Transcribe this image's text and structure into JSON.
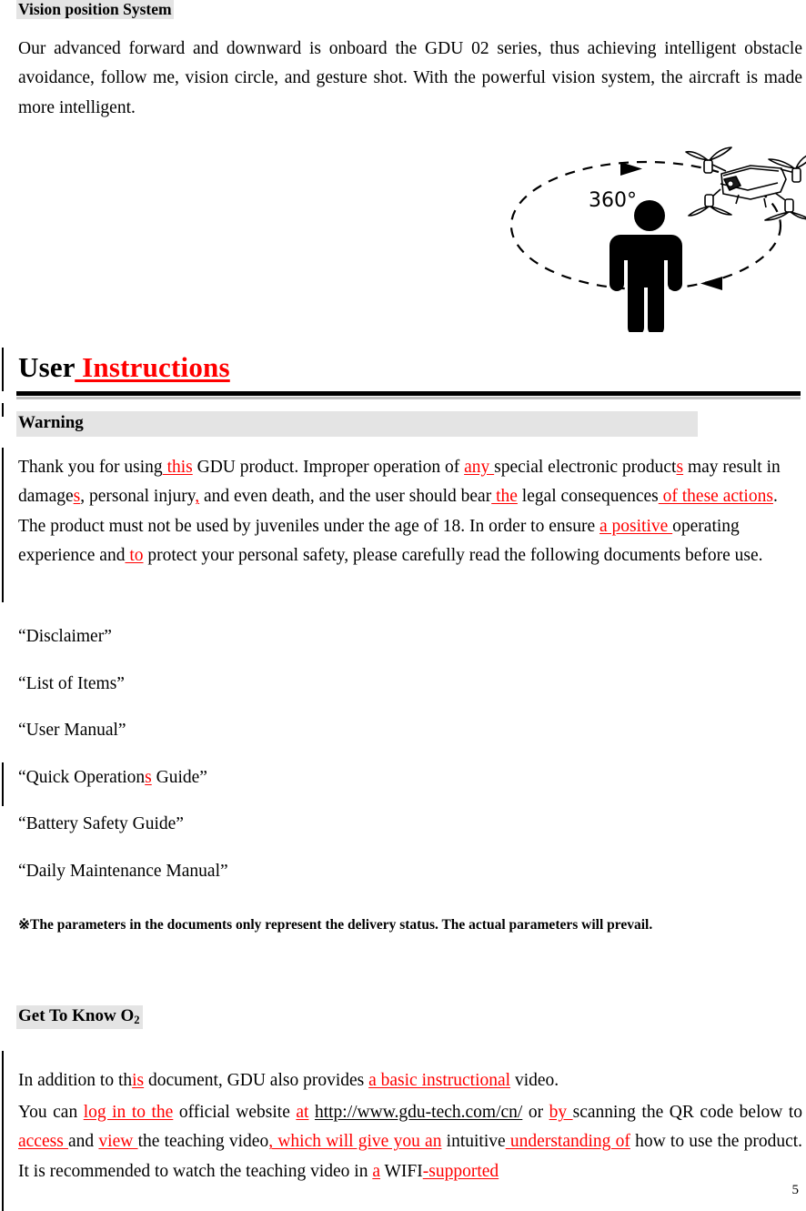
{
  "document": {
    "page_number": "5"
  },
  "vision_section": {
    "heading": "Vision position System",
    "paragraph_parts": [
      {
        "text": "Our advanced forward and downward is onboard the GDU 02 series, thus achieving intelligent obstacle avoidance, follow me, vision circle, and gesture shot. With the powerful vision system, the aircraft is made more intelligent.",
        "type": "normal"
      }
    ],
    "paragraph_plain": "Our advanced forward and downward is onboard the GDU 02 series, thus achieving intelligent obstacle avoidance, follow me, vision circle, and gesture shot. With the powerful vision system, the aircraft is made more intelligent."
  },
  "illustration": {
    "name": "orbit-diagram",
    "orbit_label": "360°",
    "elements": [
      "dashed-ellipse-orbit",
      "arrow-top-right",
      "arrow-bottom-left",
      "person-silhouette",
      "drone"
    ],
    "stroke_color": "#000000"
  },
  "user_instructions": {
    "title_static": "User",
    "title_inserted": " Instructions",
    "warning_heading": "Warning",
    "thankyou": {
      "seg1": "Thank you for using",
      "ins1": " this",
      "seg2": " GDU product. Improper operation of ",
      "ins2": "any ",
      "seg3": "special electronic product",
      "ins3": "s",
      "seg4": " may result in damage",
      "ins4": "s",
      "seg5": ", personal injury",
      "ins5": ",",
      "seg6": " and even death, and the user should bear",
      "ins6": " the",
      "seg7": " legal consequences",
      "ins7": " of these actions",
      "seg8": ". The product must not be used by juveniles under the age of 18. In order to ensure ",
      "ins8": "a positive ",
      "seg9": "operating experience and",
      "ins9": " to",
      "seg10": " protect your personal safety, please carefully read the following documents before use."
    },
    "document_list": [
      {
        "prefix": "“Disclaimer”",
        "inserted": "",
        "suffix": ""
      },
      {
        "prefix": "“List of Items”",
        "inserted": "",
        "suffix": ""
      },
      {
        "prefix": "“User Manual”",
        "inserted": "",
        "suffix": ""
      },
      {
        "prefix": "“Quick Operation",
        "inserted": "s",
        "suffix": " Guide”"
      },
      {
        "prefix": "“Battery Safety Guide”",
        "inserted": "",
        "suffix": ""
      },
      {
        "prefix": "“Daily Maintenance Manual”",
        "inserted": "",
        "suffix": ""
      }
    ],
    "note": "※The parameters in the documents only represent the delivery status. The actual parameters will prevail."
  },
  "get_to_know": {
    "heading_main": "Get To Know O",
    "heading_sub": "2",
    "addition": {
      "seg1": "In addition to th",
      "ins1": "is",
      "seg2": " document, GDU also provides ",
      "ins2": "a basic instructional",
      "seg3": " video."
    },
    "website": {
      "seg1": "You can ",
      "ins1": "log in to the",
      "seg2": " official website ",
      "ins2": "at",
      "seg3": " ",
      "url": "http://www.gdu-tech.com/cn/",
      "seg4": " or ",
      "ins3": "by ",
      "seg5": "scanning the QR code below to ",
      "ins4": "access ",
      "seg6": "and ",
      "ins5": "view ",
      "seg7": "the teaching video",
      "ins6": ", which will give you an",
      "seg8": " intuitive",
      "ins7": " understanding of",
      "seg9": " how to use the product. It is recommended to watch the teaching video in ",
      "ins8": "a",
      "seg10": " WIFI",
      "ins9": "-supported"
    }
  },
  "colors": {
    "insertion": "#ff0000",
    "highlight": "#e4e4e4",
    "rule_dark": "#000000",
    "rule_light": "#bfbfbf"
  }
}
